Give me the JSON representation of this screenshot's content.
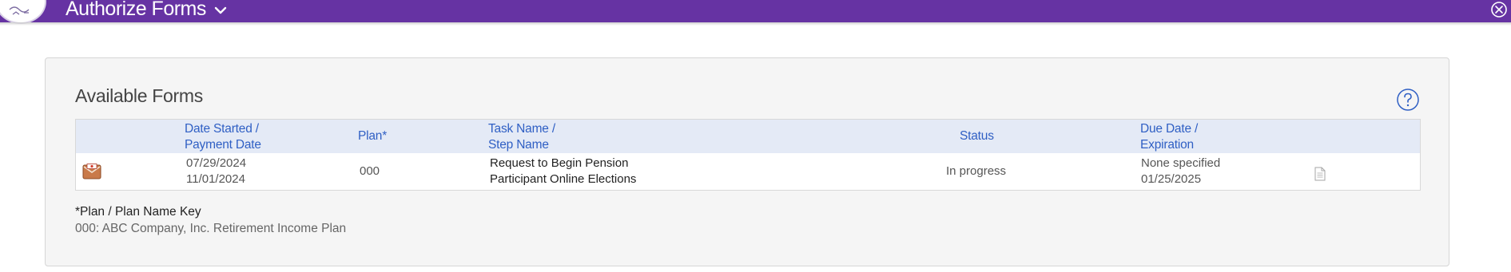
{
  "header": {
    "title": "Authorize Forms",
    "accent_color": "#6633a3",
    "menu_icon": "chevron-down-icon",
    "close_icon": "close-circle-icon"
  },
  "panel": {
    "title": "Available Forms",
    "help_icon": "help-circle-icon"
  },
  "table": {
    "headers": {
      "date_line1": "Date Started /",
      "date_line2": "Payment Date",
      "plan": "Plan*",
      "task_line1": "Task Name /",
      "task_line2": "Step Name",
      "status": "Status",
      "due_line1": "Due Date /",
      "due_line2": "Expiration"
    },
    "rows": [
      {
        "icon": "envelope-icon",
        "date_started": "07/29/2024",
        "payment_date": "11/01/2024",
        "plan": "000",
        "task_name": "Request to Begin Pension",
        "step_name": "Participant Online Elections",
        "status": "In progress",
        "due_date": "None specified",
        "expiration": "01/25/2025",
        "document_icon": "document-icon"
      }
    ]
  },
  "plan_key": {
    "title": "*Plan / Plan Name Key",
    "entry": "000: ABC Company, Inc. Retirement Income Plan"
  }
}
